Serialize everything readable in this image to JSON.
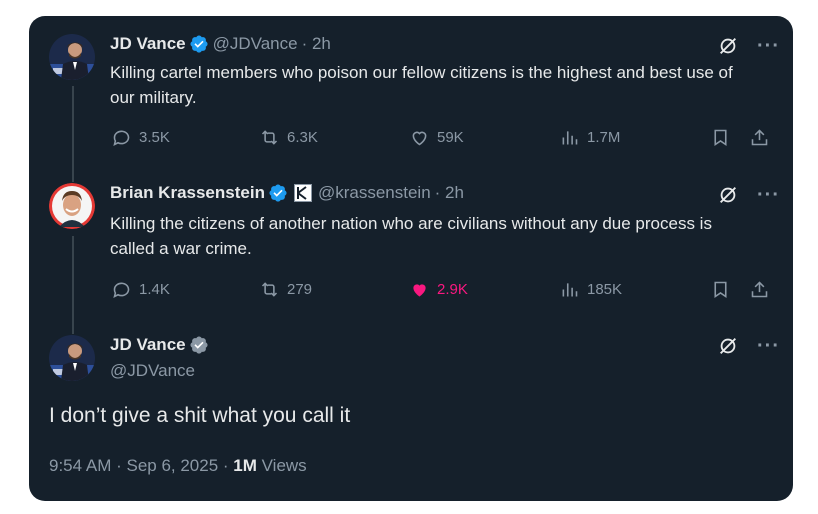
{
  "colors": {
    "background": "#15202b",
    "text": "#e7e9ea",
    "muted": "#8b98a5",
    "verified": "#1d9bf0",
    "like_pink": "#f91880"
  },
  "tweets": [
    {
      "name": "JD Vance",
      "handle": "@JDVance",
      "time": "· 2h",
      "text": "Killing cartel members who poison our fellow citizens is the highest and best use of our military.",
      "replies": "3.5K",
      "reposts": "6.3K",
      "likes": "59K",
      "views": "1.7M",
      "liked": false,
      "icons": [
        "reply-icon",
        "repost-icon",
        "like-icon",
        "views-icon",
        "bookmark-icon",
        "share-icon"
      ]
    },
    {
      "name": "Brian Krassenstein",
      "handle": "@krassenstein",
      "time": "· 2h",
      "text": "Killing the citizens of another nation who are civilians without any due process is called a war crime.",
      "replies": "1.4K",
      "reposts": "279",
      "likes": "2.9K",
      "views": "185K",
      "liked": true
    }
  ],
  "main_tweet": {
    "name": "JD Vance",
    "handle": "@JDVance",
    "text": "I don’t give a shit what you call it",
    "timestamp": "9:54 AM · Sep 6, 2025 · ",
    "views_count": "1M",
    "views_label": " Views"
  }
}
